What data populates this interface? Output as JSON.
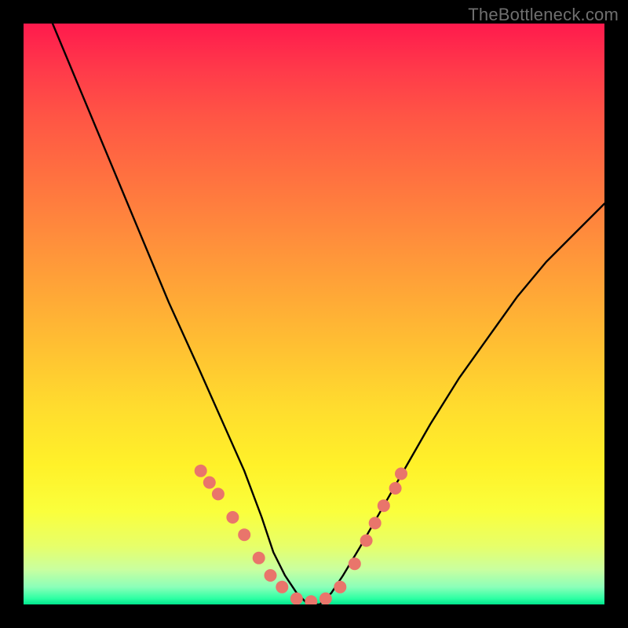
{
  "watermark": "TheBottleneck.com",
  "chart_data": {
    "type": "line",
    "title": "",
    "xlabel": "",
    "ylabel": "",
    "xlim": [
      0,
      100
    ],
    "ylim": [
      0,
      100
    ],
    "series": [
      {
        "name": "bottleneck-curve",
        "x": [
          5,
          10,
          15,
          20,
          25,
          30,
          34,
          38,
          41,
          43,
          45,
          47,
          49,
          51,
          53,
          55,
          58,
          62,
          66,
          70,
          75,
          80,
          85,
          90,
          95,
          100
        ],
        "values": [
          100,
          88,
          76,
          64,
          52,
          41,
          32,
          23,
          15,
          9,
          5,
          2,
          0,
          0,
          2,
          5,
          10,
          17,
          24,
          31,
          39,
          46,
          53,
          59,
          64,
          69
        ]
      }
    ],
    "markers": {
      "name": "highlight-dots",
      "color": "#e9756b",
      "x": [
        30.5,
        32.0,
        33.5,
        36.0,
        38.0,
        40.5,
        42.5,
        44.5,
        47.0,
        49.5,
        52.0,
        54.5,
        57.0,
        59.0,
        60.5,
        62.0,
        64.0,
        65.0
      ],
      "values": [
        23.0,
        21.0,
        19.0,
        15.0,
        12.0,
        8.0,
        5.0,
        3.0,
        1.0,
        0.5,
        1.0,
        3.0,
        7.0,
        11.0,
        14.0,
        17.0,
        20.0,
        22.5
      ]
    }
  }
}
